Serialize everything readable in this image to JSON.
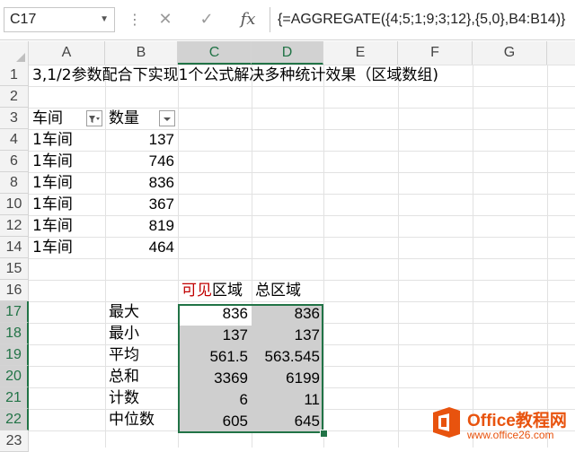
{
  "formula_bar": {
    "name_box": "C17",
    "cancel_icon": "✕",
    "confirm_icon": "✓",
    "fx_label": "fx",
    "formula": "{=AGGREGATE({4;5;1;9;3;12},{5,0},B4:B14)}"
  },
  "columns": [
    "A",
    "B",
    "C",
    "D",
    "E",
    "F",
    "G"
  ],
  "rows": [
    "1",
    "2",
    "3",
    "4",
    "6",
    "8",
    "10",
    "12",
    "14",
    "15",
    "16",
    "17",
    "18",
    "19",
    "20",
    "21",
    "22",
    "23"
  ],
  "title": "3,1/2参数配合下实现1个公式解决多种统计效果（区域数组)",
  "table": {
    "headers": [
      "车间",
      "数量"
    ],
    "rows": [
      {
        "workshop": "1车间",
        "qty": "137"
      },
      {
        "workshop": "1车间",
        "qty": "746"
      },
      {
        "workshop": "1车间",
        "qty": "836"
      },
      {
        "workshop": "1车间",
        "qty": "367"
      },
      {
        "workshop": "1车间",
        "qty": "819"
      },
      {
        "workshop": "1车间",
        "qty": "464"
      }
    ]
  },
  "stats": {
    "header_visible_prefix": "可见",
    "header_visible_suffix": "区域",
    "header_total": "总区域",
    "rows": [
      {
        "label": "最大",
        "visible": "836",
        "total": "836"
      },
      {
        "label": "最小",
        "visible": "137",
        "total": "137"
      },
      {
        "label": "平均",
        "visible": "561.5",
        "total": "563.545"
      },
      {
        "label": "总和",
        "visible": "3369",
        "total": "6199"
      },
      {
        "label": "计数",
        "visible": "6",
        "total": "11"
      },
      {
        "label": "中位数",
        "visible": "605",
        "total": "645"
      }
    ]
  },
  "watermark": {
    "brand": "Office教程网",
    "url": "www.office26.com"
  },
  "colors": {
    "accent_green": "#217346",
    "red_text": "#c00000",
    "watermark_orange": "#e8530e"
  }
}
